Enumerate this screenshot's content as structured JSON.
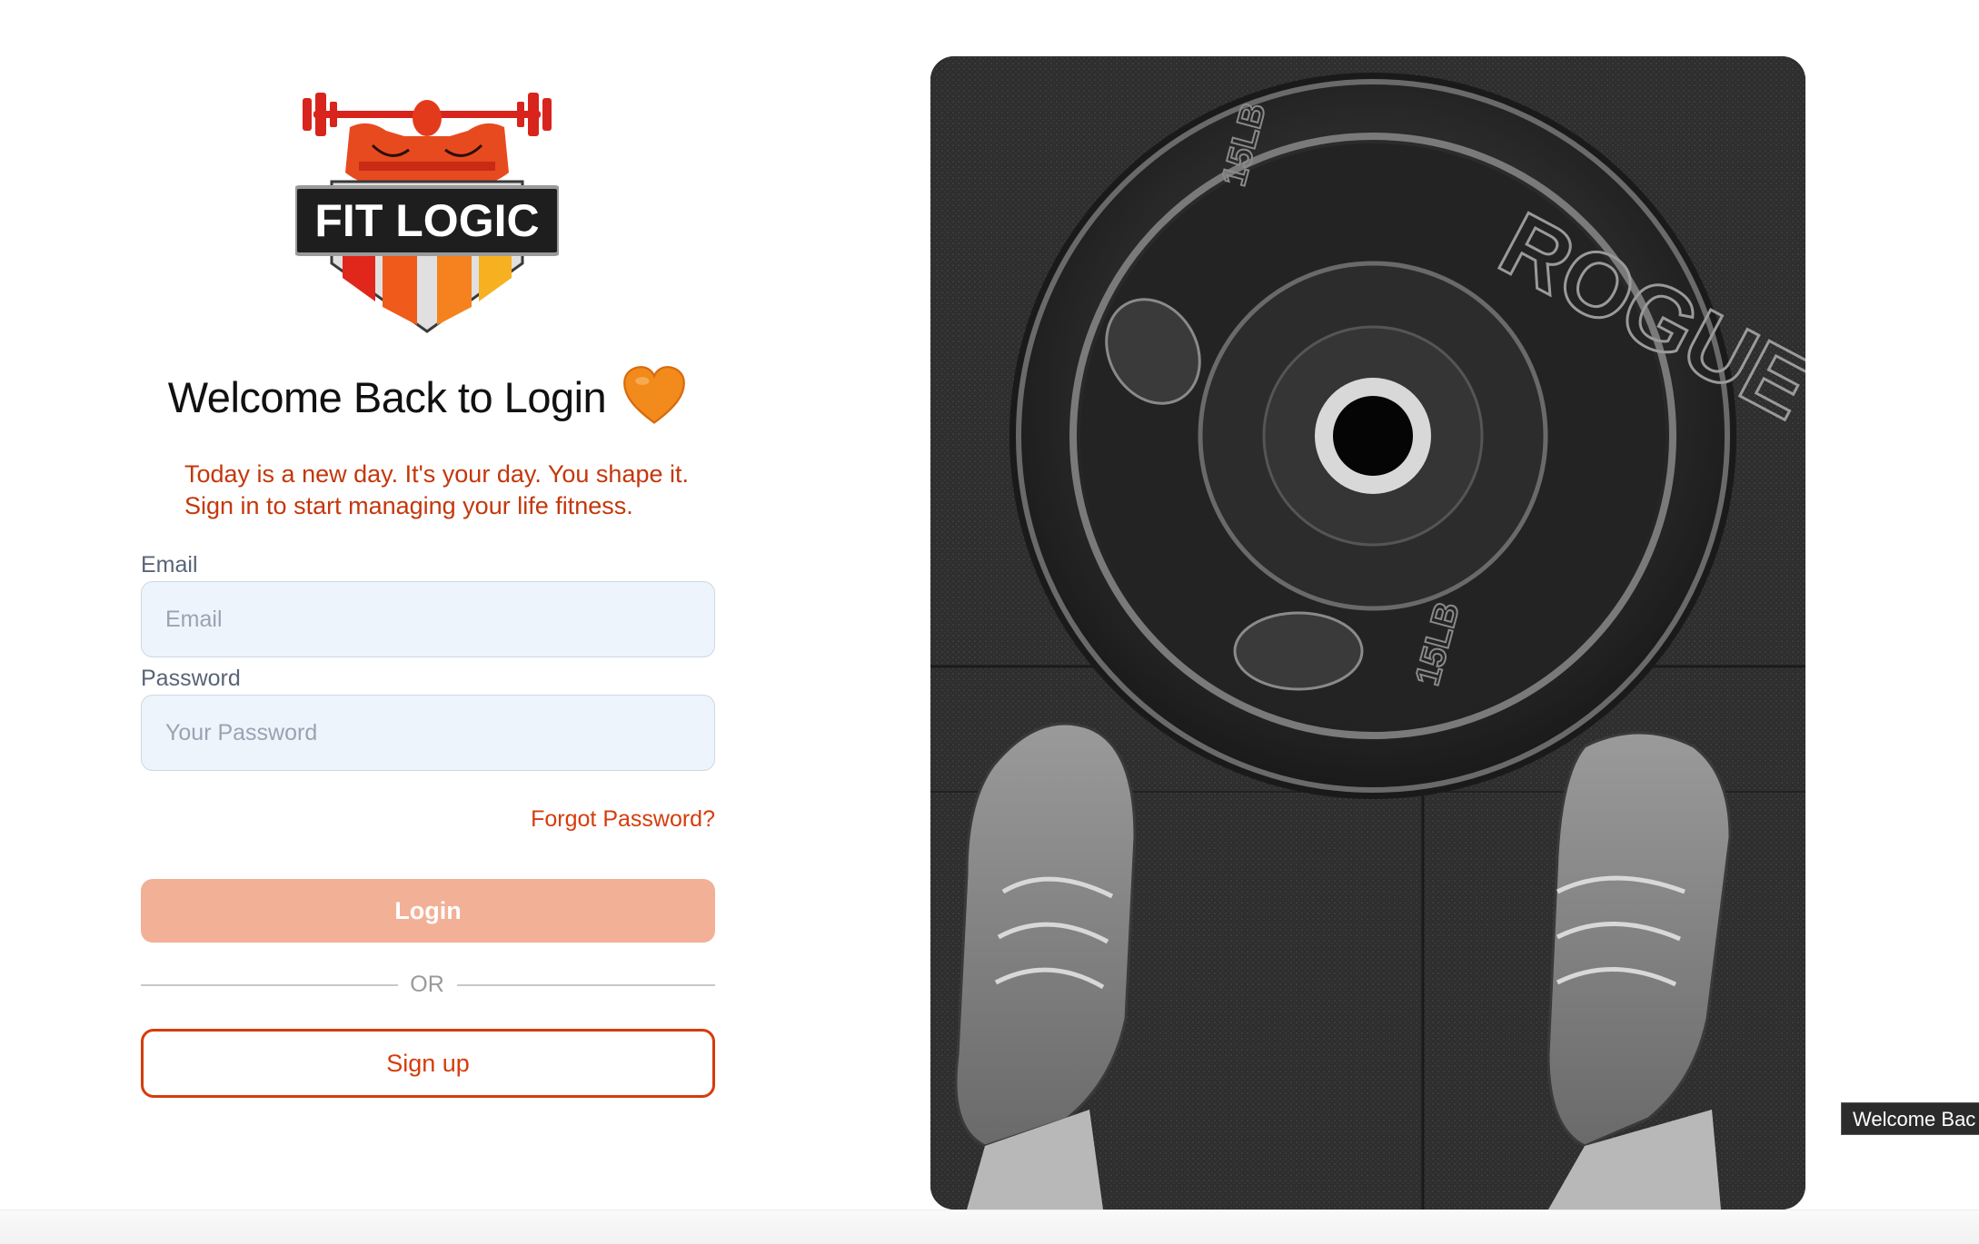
{
  "brand": {
    "logo_text": "FIT LOGIC"
  },
  "login": {
    "title": "Welcome Back to Login",
    "title_emoji": "orange-heart-icon",
    "tagline_line1": "Today is a new day. It's your day. You shape it.",
    "tagline_line2": "Sign in to start managing your life fitness.",
    "email_label": "Email",
    "email_placeholder": "Email",
    "email_value": "",
    "password_label": "Password",
    "password_placeholder": "Your Password",
    "password_value": "",
    "forgot_label": "Forgot Password?",
    "login_label": "Login",
    "divider_label": "OR",
    "signup_label": "Sign up"
  },
  "hero_image": {
    "plate_text": "ROGUE",
    "plate_weight": "15LB"
  },
  "tooltip": {
    "text": "Welcome Bac"
  },
  "colors": {
    "accent": "#d63c0b",
    "accent_text": "#c4370b",
    "login_button": "#f2b096",
    "input_bg": "#eef4fb",
    "label": "#5a6478"
  }
}
